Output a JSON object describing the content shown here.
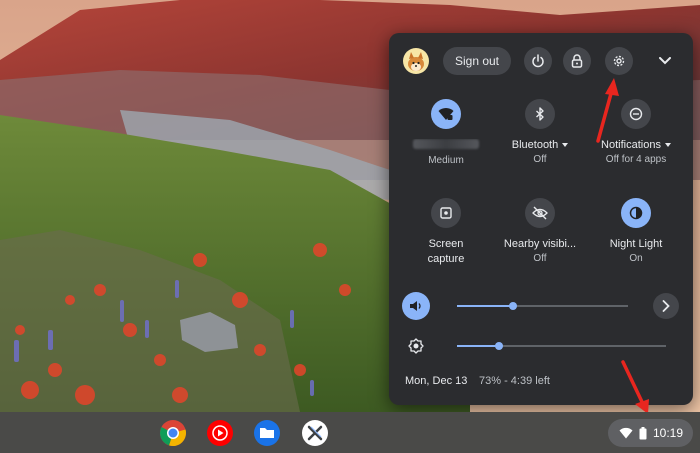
{
  "quick_settings": {
    "sign_out_label": "Sign out",
    "tiles": [
      {
        "id": "wifi",
        "sub": "Medium",
        "on": true
      },
      {
        "id": "bluetooth",
        "label": "Bluetooth",
        "sub": "Off",
        "on": false
      },
      {
        "id": "notifications",
        "label": "Notifications",
        "sub": "Off for 4 apps",
        "on": false
      },
      {
        "id": "screen-capture",
        "label": "Screen",
        "label2": "capture",
        "on": false
      },
      {
        "id": "nearby",
        "label": "Nearby visibi...",
        "sub": "Off",
        "on": false
      },
      {
        "id": "night-light",
        "label": "Night Light",
        "sub": "On",
        "on": true
      }
    ],
    "volume_level": 0.33,
    "brightness_level": 0.2,
    "date": "Mon, Dec 13",
    "battery": "73% - 4:39 left"
  },
  "shelf": {
    "apps": [
      "chrome-icon",
      "youtube-music-icon",
      "files-icon",
      "app-icon"
    ],
    "time": "10:19"
  },
  "colors": {
    "panel": "#2b2c2f",
    "accent": "#8ab4f8",
    "annotation_arrow": "#e8261f"
  }
}
